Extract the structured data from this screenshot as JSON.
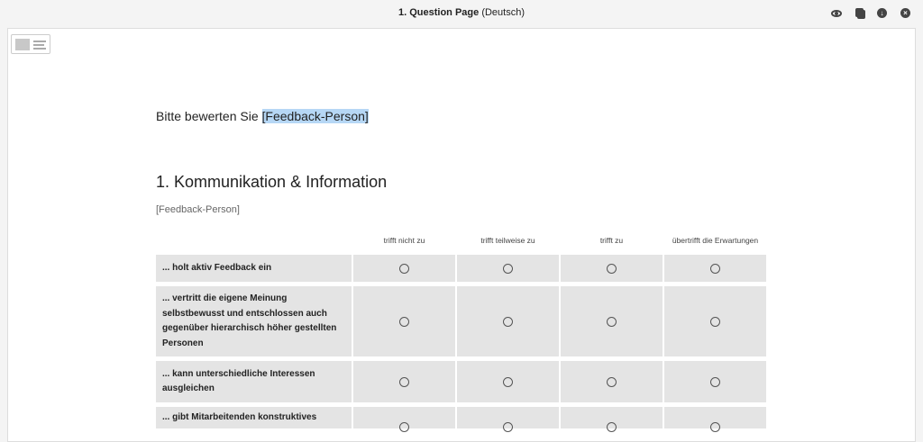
{
  "header": {
    "title_bold": "1. Question Page",
    "title_lang": "(Deutsch)",
    "icons": [
      "eye-icon",
      "copy-icon",
      "download-icon",
      "close-icon"
    ]
  },
  "page": {
    "intro_prefix": "Bitte bewerten Sie",
    "intro_placeholder": "[Feedback-Person]",
    "section_title": "1. Kommunikation & Information",
    "section_subtitle": "[Feedback-Person]"
  },
  "matrix": {
    "columns": [
      "trifft nicht zu",
      "trifft teilweise zu",
      "trifft zu",
      "übertrifft die Erwartungen"
    ],
    "rows": [
      {
        "label": "... holt aktiv Feedback ein"
      },
      {
        "label": "... vertritt die eigene Meinung selbstbewusst und entschlossen auch gegenüber hierarchisch höher gestellten Personen"
      },
      {
        "label": "... kann unterschiedliche Interessen ausgleichen"
      },
      {
        "label": "... gibt Mitarbeitenden konstruktives"
      }
    ]
  }
}
